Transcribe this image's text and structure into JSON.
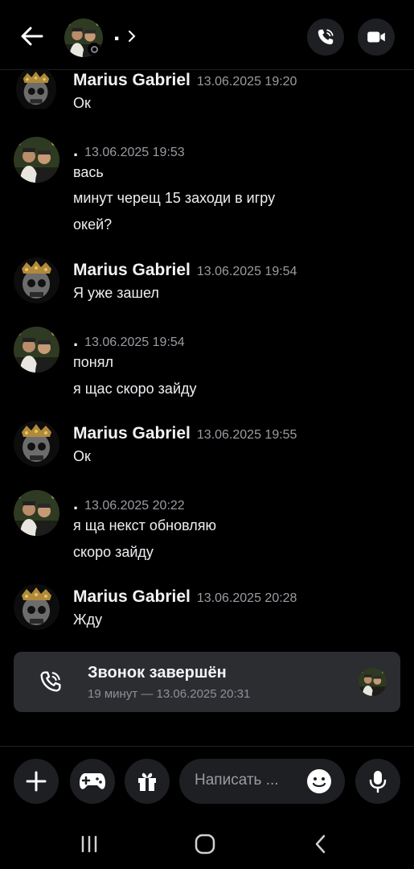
{
  "header": {
    "name": ".",
    "back_icon": "arrow-left-icon",
    "call_icon": "phone-call-icon",
    "video_icon": "video-camera-icon"
  },
  "messages": [
    {
      "author": "Marius Gabriel",
      "time": "13.06.2025 19:20",
      "lines": [
        "Ок"
      ]
    },
    {
      "author": ".",
      "time": "13.06.2025 19:53",
      "lines": [
        "вась",
        "минут черещ 15 заходи в игру",
        "окей?"
      ]
    },
    {
      "author": "Marius Gabriel",
      "time": "13.06.2025 19:54",
      "lines": [
        "Я уже зашел"
      ]
    },
    {
      "author": ".",
      "time": "13.06.2025 19:54",
      "lines": [
        "понял",
        "я щас скоро зайду"
      ]
    },
    {
      "author": "Marius Gabriel",
      "time": "13.06.2025 19:55",
      "lines": [
        "Ок"
      ]
    },
    {
      "author": ".",
      "time": "13.06.2025 20:22",
      "lines": [
        "я ща некст обновляю",
        "скоро зайду"
      ]
    },
    {
      "author": "Marius Gabriel",
      "time": "13.06.2025 20:28",
      "lines": [
        "Жду"
      ]
    }
  ],
  "call_card": {
    "title": "Звонок завершён",
    "subtitle": "19 минут — 13.06.2025 20:31"
  },
  "composer": {
    "placeholder": "Написать ...",
    "buttons": [
      "plus-icon",
      "gamepad-icon",
      "gift-icon",
      "emoji-icon",
      "microphone-icon"
    ]
  },
  "colors": {
    "background": "#000000",
    "surface": "#1e1f22",
    "card": "#2b2d31",
    "muted_text": "#9a9ca2"
  }
}
